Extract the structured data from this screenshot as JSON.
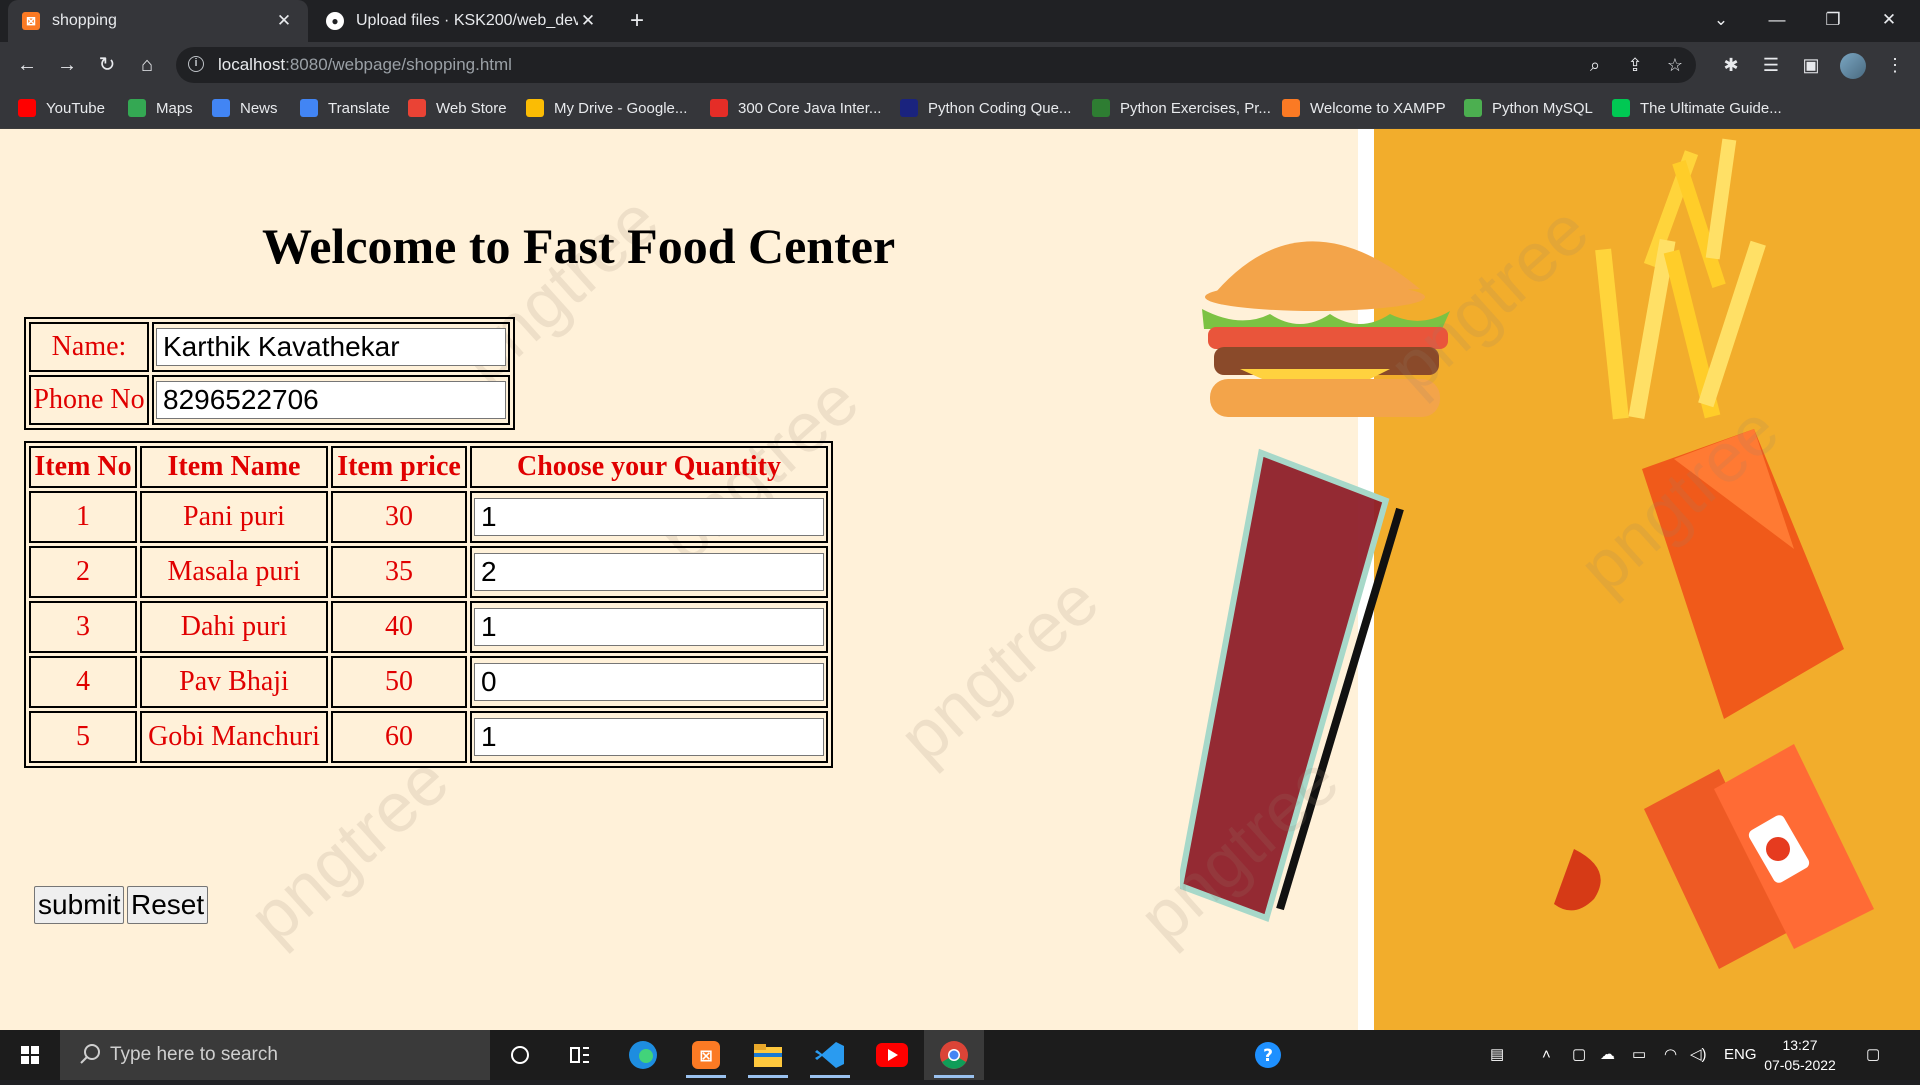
{
  "browser": {
    "tabs": [
      {
        "title": "shopping",
        "active": true
      },
      {
        "title": "Upload files · KSK200/web_develo",
        "active": false
      }
    ],
    "url_host": "localhost",
    "url_rest": ":8080/webpage/shopping.html",
    "bookmarks": [
      {
        "label": "YouTube",
        "icon": "youtube-icon",
        "color": "#ff0000"
      },
      {
        "label": "Maps",
        "icon": "maps-icon",
        "color": "#34a853"
      },
      {
        "label": "News",
        "icon": "news-icon",
        "color": "#4285f4"
      },
      {
        "label": "Translate",
        "icon": "translate-icon",
        "color": "#4285f4"
      },
      {
        "label": "Web Store",
        "icon": "webstore-icon",
        "color": "#ea4335"
      },
      {
        "label": "My Drive - Google...",
        "icon": "drive-icon",
        "color": "#fbbc04"
      },
      {
        "label": "300 Core Java Inter...",
        "icon": "java-icon",
        "color": "#e52d27"
      },
      {
        "label": "Python Coding Que...",
        "icon": "bracket-icon",
        "color": "#1a237e"
      },
      {
        "label": "Python Exercises, Pr...",
        "icon": "w3-icon",
        "color": "#2e7d32"
      },
      {
        "label": "Welcome to XAMPP",
        "icon": "xampp-icon",
        "color": "#fb7a24"
      },
      {
        "label": "Python MySQL",
        "icon": "w3-icon",
        "color": "#4caf50"
      },
      {
        "label": "The Ultimate Guide...",
        "icon": "check-icon",
        "color": "#00c853"
      }
    ]
  },
  "page": {
    "heading": "Welcome to Fast Food Center",
    "form": {
      "name_label": "Name:",
      "name_value": "Karthik Kavathekar",
      "phone_label": "Phone No",
      "phone_value": "8296522706"
    },
    "menu": {
      "headers": [
        "Item No",
        "Item Name",
        "Item price",
        "Choose your Quantity"
      ],
      "rows": [
        {
          "no": "1",
          "name": "Pani puri",
          "price": "30",
          "qty": "1"
        },
        {
          "no": "2",
          "name": "Masala puri",
          "price": "35",
          "qty": "2"
        },
        {
          "no": "3",
          "name": "Dahi puri",
          "price": "40",
          "qty": "1"
        },
        {
          "no": "4",
          "name": "Pav Bhaji",
          "price": "50",
          "qty": "0"
        },
        {
          "no": "5",
          "name": "Gobi Manchuri",
          "price": "60",
          "qty": "1"
        }
      ]
    },
    "buttons": {
      "submit": "submit",
      "reset": "Reset"
    },
    "watermark": "pngtree"
  },
  "taskbar": {
    "search_placeholder": "Type here to search",
    "lang": "ENG",
    "time": "13:27",
    "date": "07-05-2022"
  },
  "colors": {
    "label_red": "#e00000",
    "page_bg": "#fff1d9",
    "art_orange": "#f2ad2c"
  }
}
